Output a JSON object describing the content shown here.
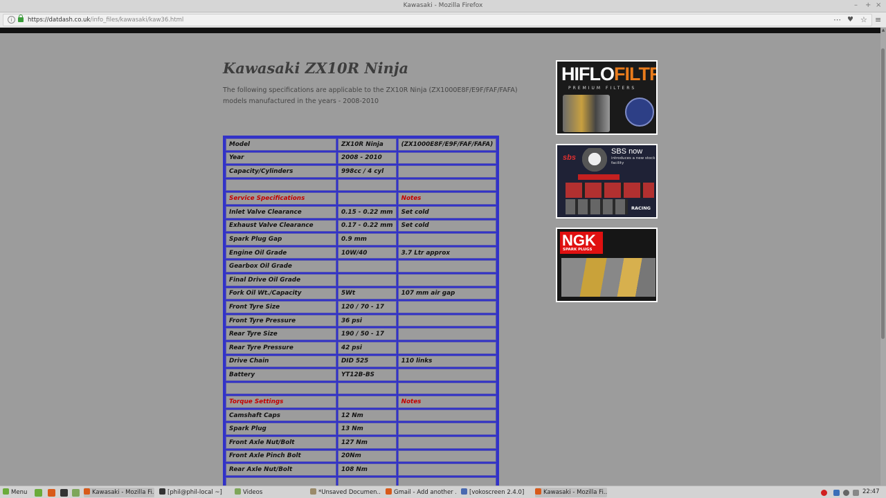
{
  "window": {
    "title": "Kawasaki - Mozilla Firefox"
  },
  "browser": {
    "url_domain": "https://datdash.co.uk",
    "url_path": "/info_files/kawasaki/kaw36.html"
  },
  "page": {
    "heading": "Kawasaki ZX10R Ninja",
    "intro": "The following specifications are applicable to the ZX10R Ninja (ZX1000E8F/E9F/FAF/FAFA) models manufactured in the years - 2008-2010"
  },
  "spec_table": [
    {
      "c1": "Model",
      "c2": "ZX10R Ninja",
      "c3": "(ZX1000E8F/E9F/FAF/FAFA)"
    },
    {
      "c1": "Year",
      "c2": "2008 - 2010",
      "c3": ""
    },
    {
      "c1": "Capacity/Cylinders",
      "c2": "998cc / 4 cyl",
      "c3": ""
    },
    {
      "c1": "",
      "c2": "",
      "c3": ""
    },
    {
      "c1": "Service Specifications",
      "c2": "",
      "c3": "Notes",
      "red": true
    },
    {
      "c1": "Inlet Valve Clearance",
      "c2": "0.15 - 0.22 mm",
      "c3": "Set cold"
    },
    {
      "c1": "Exhaust Valve Clearance",
      "c2": "0.17 - 0.22 mm",
      "c3": "Set cold"
    },
    {
      "c1": "Spark Plug Gap",
      "c2": "0.9 mm",
      "c3": ""
    },
    {
      "c1": "Engine Oil Grade",
      "c2": "10W/40",
      "c3": "3.7 Ltr approx"
    },
    {
      "c1": "Gearbox Oil Grade",
      "c2": "",
      "c3": ""
    },
    {
      "c1": "Final Drive Oil Grade",
      "c2": "",
      "c3": ""
    },
    {
      "c1": "Fork Oil Wt./Capacity",
      "c2": "5Wt",
      "c3": "107 mm air gap"
    },
    {
      "c1": "Front Tyre Size",
      "c2": "120 / 70 - 17",
      "c3": ""
    },
    {
      "c1": "Front Tyre Pressure",
      "c2": "36 psi",
      "c3": ""
    },
    {
      "c1": "Rear Tyre Size",
      "c2": "190 / 50 - 17",
      "c3": ""
    },
    {
      "c1": "Rear Tyre Pressure",
      "c2": "42 psi",
      "c3": ""
    },
    {
      "c1": "Drive Chain",
      "c2": "DID 525",
      "c3": "110 links"
    },
    {
      "c1": "Battery",
      "c2": "YT12B-BS",
      "c3": ""
    },
    {
      "c1": "",
      "c2": "",
      "c3": ""
    },
    {
      "c1": "Torque Settings",
      "c2": "",
      "c3": "Notes",
      "red": true
    },
    {
      "c1": "Camshaft Caps",
      "c2": "12 Nm",
      "c3": ""
    },
    {
      "c1": "Spark Plug",
      "c2": "13 Nm",
      "c3": ""
    },
    {
      "c1": "Front Axle Nut/Bolt",
      "c2": "127 Nm",
      "c3": ""
    },
    {
      "c1": "Front Axle Pinch Bolt",
      "c2": "20Nm",
      "c3": ""
    },
    {
      "c1": "Rear Axle Nut/Bolt",
      "c2": "108 Nm",
      "c3": ""
    },
    {
      "c1": "",
      "c2": "",
      "c3": ""
    }
  ],
  "ads": {
    "hiflo": {
      "logo_a": "HIFLO",
      "logo_b": "FILTRO",
      "sub": "PREMIUM FILTERS"
    },
    "sbs": {
      "brand": "sbs",
      "headline": "SBS now",
      "text": "introduces a new stock facility",
      "racing": "RACING"
    },
    "ngk": {
      "brand": "NGK",
      "sub": "SPARK PLUGS"
    }
  },
  "taskbar": {
    "menu": "Menu",
    "items": [
      {
        "label": "Kawasaki - Mozilla Fi...",
        "icon": "firefox-icon"
      },
      {
        "label": "[phil@phil-local ~]",
        "icon": "terminal-icon"
      },
      {
        "label": "Videos",
        "icon": "folder-icon"
      },
      {
        "label": "*Unsaved Documen...",
        "icon": "text-editor-icon"
      },
      {
        "label": "Gmail - Add another ...",
        "icon": "firefox-icon"
      },
      {
        "label": "[vokoscreen 2.4.0]",
        "icon": "vokoscreen-icon"
      },
      {
        "label": "Kawasaki - Mozilla Fi...",
        "icon": "firefox-icon"
      }
    ],
    "clock": "22:47"
  }
}
